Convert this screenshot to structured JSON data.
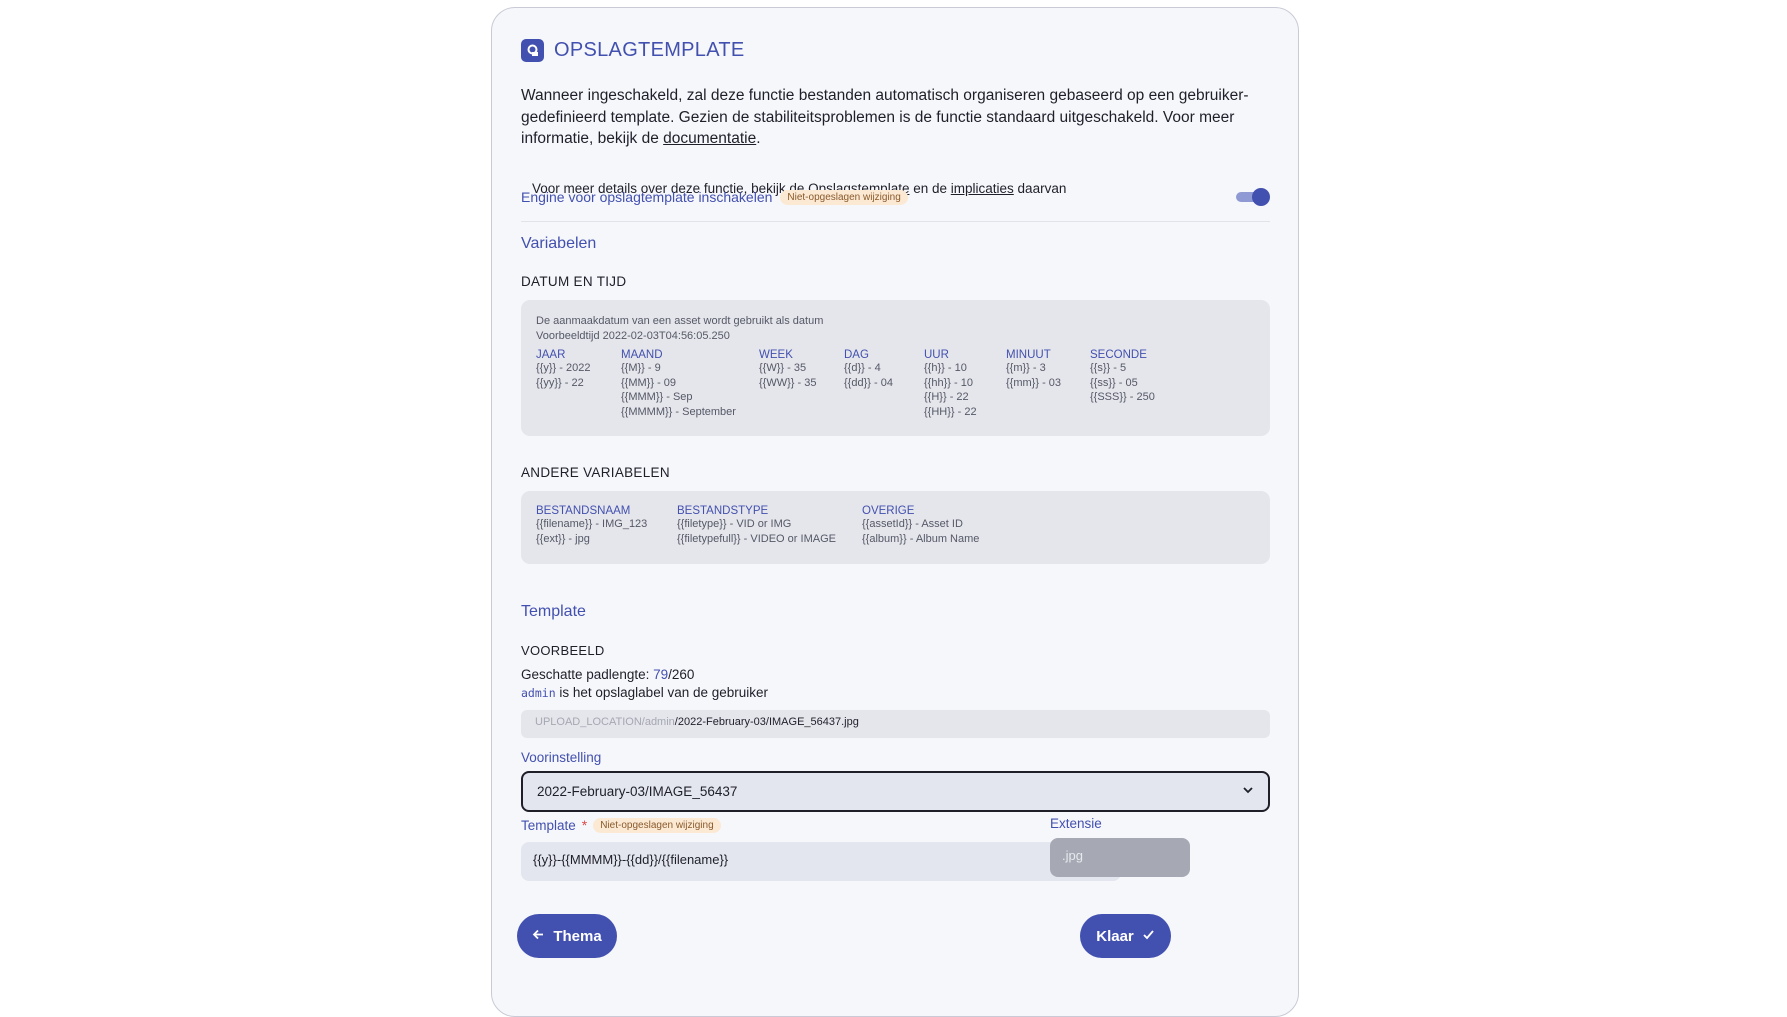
{
  "header": {
    "title": "OPSLAGTEMPLATE",
    "icon": "storage-template-icon"
  },
  "intro": {
    "text_before": "Wanneer ingeschakeld, zal deze functie bestanden automatisch organiseren gebaseerd op een gebruiker-gedefinieerd template. Gezien de stabiliteitsproblemen is de functie standaard uitgeschakeld. Voor meer informatie, bekijk de ",
    "link": "documentatie",
    "text_after": "."
  },
  "note": {
    "prefix": "Voor meer details over deze functie, bekijk de ",
    "link1": "Opslagstemplate",
    "middle": " en de ",
    "link2": "implicaties",
    "suffix": " daarvan"
  },
  "engine": {
    "label": "Engine voor opslagtemplate inschakelen",
    "badge": "Niet-opgeslagen wijziging",
    "enabled": true
  },
  "variables": {
    "title": "Variabelen",
    "datetime": {
      "title": "DATUM EN TIJD",
      "desc1": "De aanmaakdatum van een asset wordt gebruikt als datum",
      "desc2": "Voorbeeldtijd 2022-02-03T04:56:05.250",
      "columns": [
        {
          "head": "JAAR",
          "lines": [
            "{{y}} - 2022",
            "{{yy}} - 22"
          ]
        },
        {
          "head": "MAAND",
          "lines": [
            "{{M}} - 9",
            "{{MM}} - 09",
            "{{MMM}} - Sep",
            "{{MMMM}} - September"
          ]
        },
        {
          "head": "WEEK",
          "lines": [
            "{{W}} - 35",
            "{{WW}} - 35"
          ]
        },
        {
          "head": "DAG",
          "lines": [
            "{{d}} - 4",
            "{{dd}} - 04"
          ]
        },
        {
          "head": "UUR",
          "lines": [
            "{{h}} - 10",
            "{{hh}} - 10",
            "{{H}} - 22",
            "{{HH}} - 22"
          ]
        },
        {
          "head": "MINUUT",
          "lines": [
            "{{m}} - 3",
            "{{mm}} - 03"
          ]
        },
        {
          "head": "SECONDE",
          "lines": [
            "{{s}} - 5",
            "{{ss}} - 05",
            "{{SSS}} - 250"
          ]
        }
      ]
    },
    "other": {
      "title": "ANDERE VARIABELEN",
      "columns": [
        {
          "head": "BESTANDSNAAM",
          "lines": [
            "{{filename}} - IMG_123",
            "{{ext}} - jpg"
          ]
        },
        {
          "head": "BESTANDSTYPE",
          "lines": [
            "{{filetype}} - VID or IMG",
            "{{filetypefull}} - VIDEO or IMAGE"
          ]
        },
        {
          "head": "OVERIGE",
          "lines": [
            "{{assetId}} - Asset ID",
            "{{album}} - Album Name"
          ]
        }
      ]
    }
  },
  "template": {
    "title": "Template",
    "preview_title": "VOORBEELD",
    "path_length_label": "Geschatte padlengte: ",
    "path_length_value": "79",
    "path_length_max": "/260",
    "storage_label_user": "admin",
    "storage_label_text": " is het opslaglabel van de gebruiker",
    "path_prefix": "UPLOAD_LOCATION/admin",
    "path_value": "/2022-February-03/IMAGE_56437.jpg",
    "preset_label": "Voorinstelling",
    "preset_value": "2022-February-03/IMAGE_56437",
    "template_label": "Template",
    "required_mark": "*",
    "template_badge": "Niet-opgeslagen wijziging",
    "template_value": "{{y}}-{{MMMM}}-{{dd}}/{{filename}}",
    "extension_label": "Extensie",
    "extension_value": ".jpg"
  },
  "buttons": {
    "back": "Thema",
    "done": "Klaar"
  },
  "colors": {
    "accent": "#4250af",
    "badge_bg": "#fbe9d4",
    "panel_bg": "#e5e6ec"
  }
}
